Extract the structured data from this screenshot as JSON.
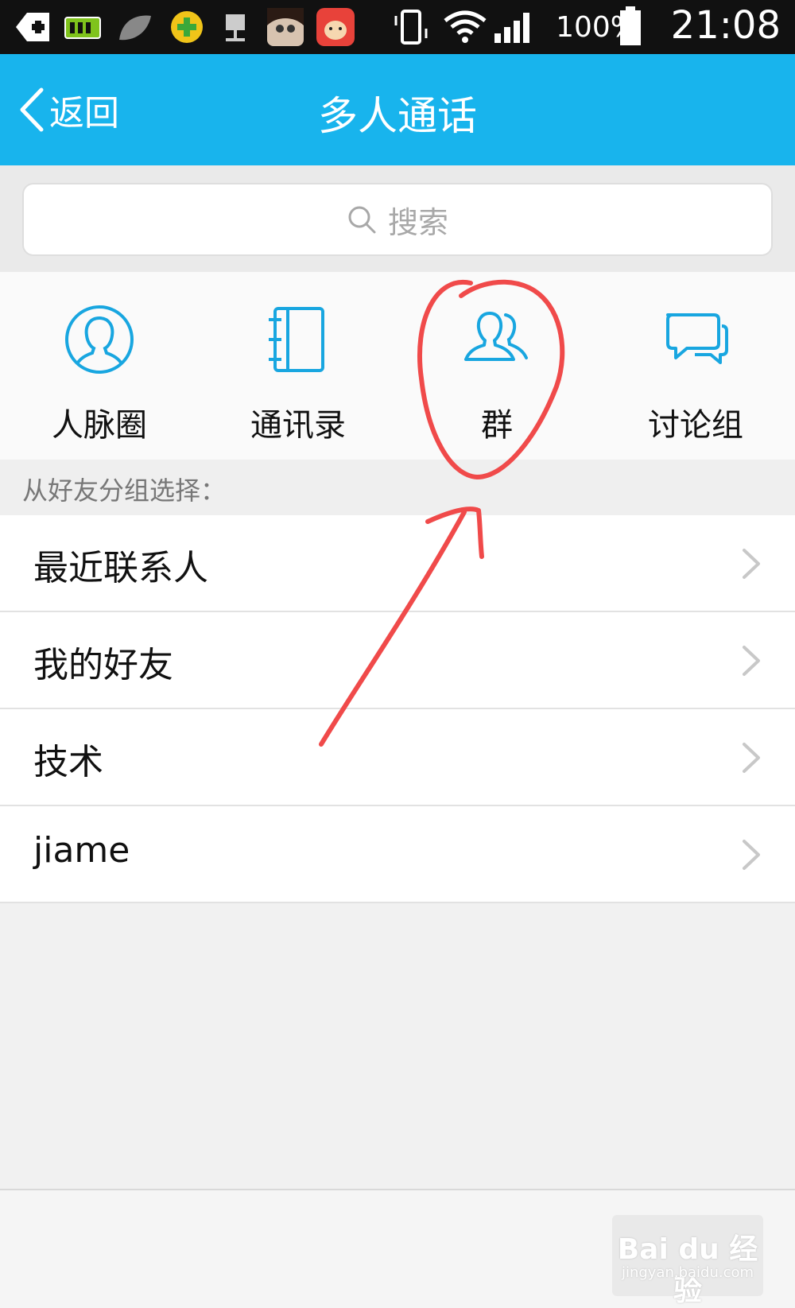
{
  "status_bar": {
    "battery_pct": "100%",
    "time": "21:08",
    "icons": [
      "plus-app-icon",
      "battery-app-icon",
      "leaf-icon",
      "security-app-icon",
      "transfer-icon",
      "avatar-app-icon",
      "cow-app-icon",
      "vibrate-icon",
      "wifi-icon",
      "signal-icon",
      "battery-icon"
    ]
  },
  "header": {
    "back_label": "返回",
    "title": "多人通话",
    "bg_color": "#18b4ed"
  },
  "search": {
    "placeholder": "搜索"
  },
  "quick_entries": [
    {
      "label": "人脉圈",
      "icon": "contact-circle-icon"
    },
    {
      "label": "通讯录",
      "icon": "address-book-icon"
    },
    {
      "label": "群",
      "icon": "group-icon"
    },
    {
      "label": "讨论组",
      "icon": "chat-bubbles-icon"
    }
  ],
  "section_label": "从好友分组选择：",
  "groups": [
    {
      "label": "最近联系人"
    },
    {
      "label": "我的好友"
    },
    {
      "label": "技术"
    },
    {
      "label": "jiame"
    }
  ],
  "watermark": {
    "main": "Bai du 经验",
    "sub": "jingyan.baidu.com"
  },
  "annotation_color": "#f04a4a"
}
